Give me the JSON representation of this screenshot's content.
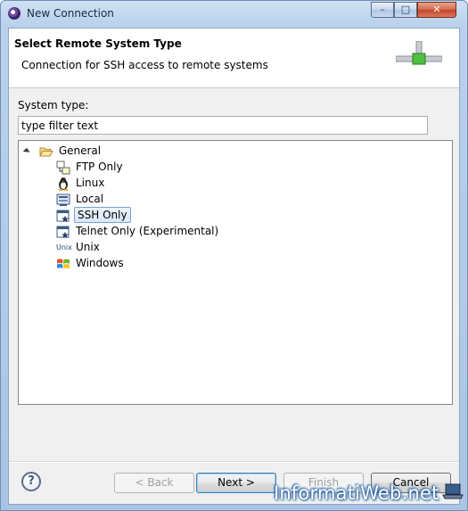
{
  "window": {
    "title": "New Connection"
  },
  "titlebar_buttons": {
    "minimize": "–",
    "maximize": "□",
    "close": "✕"
  },
  "header": {
    "title": "Select Remote System Type",
    "description": "Connection for SSH access to remote systems"
  },
  "system_type": {
    "label": "System type:",
    "filter_value": "type filter text"
  },
  "tree": {
    "root": {
      "label": "General",
      "icon": "folder-open-icon",
      "expanded": true
    },
    "items": [
      {
        "label": "FTP Only",
        "icon": "ftp-icon",
        "selected": false
      },
      {
        "label": "Linux",
        "icon": "linux-penguin-icon",
        "selected": false
      },
      {
        "label": "Local",
        "icon": "local-computer-icon",
        "selected": false
      },
      {
        "label": "SSH Only",
        "icon": "ssh-terminal-icon",
        "selected": true
      },
      {
        "label": "Telnet Only (Experimental)",
        "icon": "telnet-terminal-icon",
        "selected": false
      },
      {
        "label": "Unix",
        "icon": "unix-icon",
        "icon_text": "Unix",
        "selected": false
      },
      {
        "label": "Windows",
        "icon": "windows-flag-icon",
        "selected": false
      }
    ]
  },
  "buttons": {
    "help": "?",
    "back": "< Back",
    "next": "Next >",
    "finish": "Finish",
    "cancel": "Cancel"
  },
  "watermark": "InformatiWeb.net",
  "colors": {
    "selection_border": "#7da2ce",
    "selection_fill": "#d9e7f9",
    "title_gradient": "#b9d1ec"
  }
}
